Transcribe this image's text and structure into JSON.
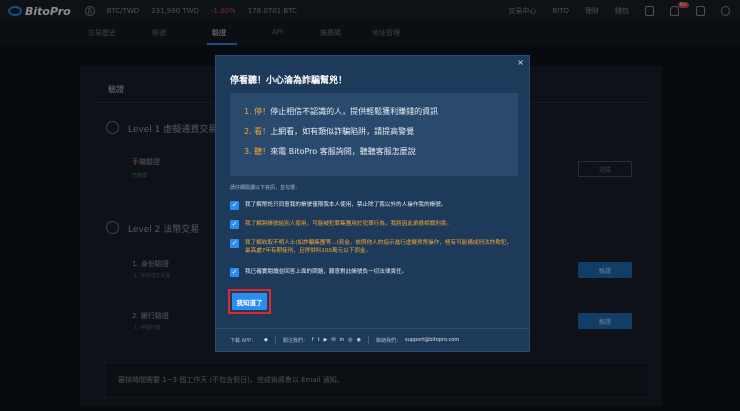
{
  "app": {
    "name": "BitoPro"
  },
  "ticker": {
    "pair": "BTC/TWD",
    "price": "231,990 TWD",
    "change": "-1.00%",
    "volume": "178.0701 BTC"
  },
  "topnav": {
    "items": [
      "交易中心",
      "BITO",
      "理財",
      "錢包"
    ],
    "notif_badge": "9+"
  },
  "subnav": {
    "tabs": [
      "交易歷史",
      "帳號",
      "驗證",
      "API",
      "推薦碼",
      "地址管理"
    ],
    "active": "驗證"
  },
  "background": {
    "card_title": "驗證",
    "level1": "Level 1 虛擬通貨交易",
    "phone_label": "手機驗證",
    "phone_status": "已完成",
    "done_btn": "完成",
    "level2": "Level 2 法幣交易",
    "id_label": "1. 身份驗證",
    "id_sub": "1. 身份證正反面",
    "bank_label": "2. 銀行驗證",
    "bank_sub": "1. 存摺封面",
    "verify_btn": "驗證",
    "footnote": "審核時間需要 1~3 個工作天 (不包含假日)，完成後將會以 Email 通知。"
  },
  "modal": {
    "close": "×",
    "title": "停看聽！小心淪為詐騙幫兇！",
    "tips": [
      {
        "lead": "1. 停！",
        "text": "停止相信不認識的人，提供輕鬆獲利賺錢的資訊"
      },
      {
        "lead": "2. 看！",
        "text": "上網看，如有類似詐騙陷阱，請提高警覺"
      },
      {
        "lead": "3. 聽！",
        "text": "來電 BitoPro 客服詢問，聽聽客服怎麼說"
      }
    ],
    "prompt": "請仔細閱讀以下資訊，並勾選：",
    "checks": [
      "我了解幣託只同意我的帳號僅限我本人使用，禁止除了我以外的人操作我的帳號。",
      "我了解將帳號給別人使用，可能被犯罪集團用於犯罪行為，我將因此承擔相關刑責。",
      "我了解收取不明人士(如詐騙集團等...)資金，依照他人的指示進行虛擬貨幣操作，極有可能構成刑法詐欺犯，最高處7年有期徒刑，且得併科100萬元以下罰金。",
      "我已確實閱讀並回答上面的問題，願意對此帳號負一切法律責任。"
    ],
    "confirm": "我知道了",
    "footer": {
      "download": "下載 APP：",
      "follow": "關注我們：",
      "social": [
        "f",
        "t",
        "▶",
        "✉",
        "in",
        "◎",
        "◉"
      ],
      "contact": "聯絡我們：",
      "email": "support@bitopro.com"
    }
  }
}
